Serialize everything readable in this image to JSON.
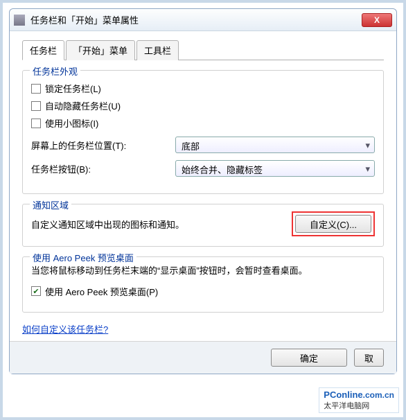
{
  "window": {
    "title": "任务栏和「开始」菜单属性",
    "close": "X"
  },
  "tabs": [
    {
      "label": "任务栏",
      "active": true
    },
    {
      "label": "「开始」菜单",
      "active": false
    },
    {
      "label": "工具栏",
      "active": false
    }
  ],
  "appearance": {
    "legend": "任务栏外观",
    "lock": {
      "label": "锁定任务栏(L)",
      "checked": false
    },
    "autohide": {
      "label": "自动隐藏任务栏(U)",
      "checked": false
    },
    "small_icons": {
      "label": "使用小图标(I)",
      "checked": false
    },
    "position_label": "屏幕上的任务栏位置(T):",
    "position_value": "底部",
    "buttons_label": "任务栏按钮(B):",
    "buttons_value": "始终合并、隐藏标签"
  },
  "notification": {
    "legend": "通知区域",
    "text": "自定义通知区域中出现的图标和通知。",
    "customize_label": "自定义(C)..."
  },
  "aero": {
    "legend": "使用 Aero Peek 预览桌面",
    "desc": "当您将鼠标移动到任务栏末端的“显示桌面”按钮时，会暂时查看桌面。",
    "check": {
      "label": "使用 Aero Peek 预览桌面(P)",
      "checked": true
    }
  },
  "help_link": "如何自定义该任务栏?",
  "buttons": {
    "ok": "确定",
    "cancel": "取"
  },
  "watermark": {
    "brand": "PConline",
    "dom": ".com.cn",
    "sub": "太平洋电脑网"
  }
}
